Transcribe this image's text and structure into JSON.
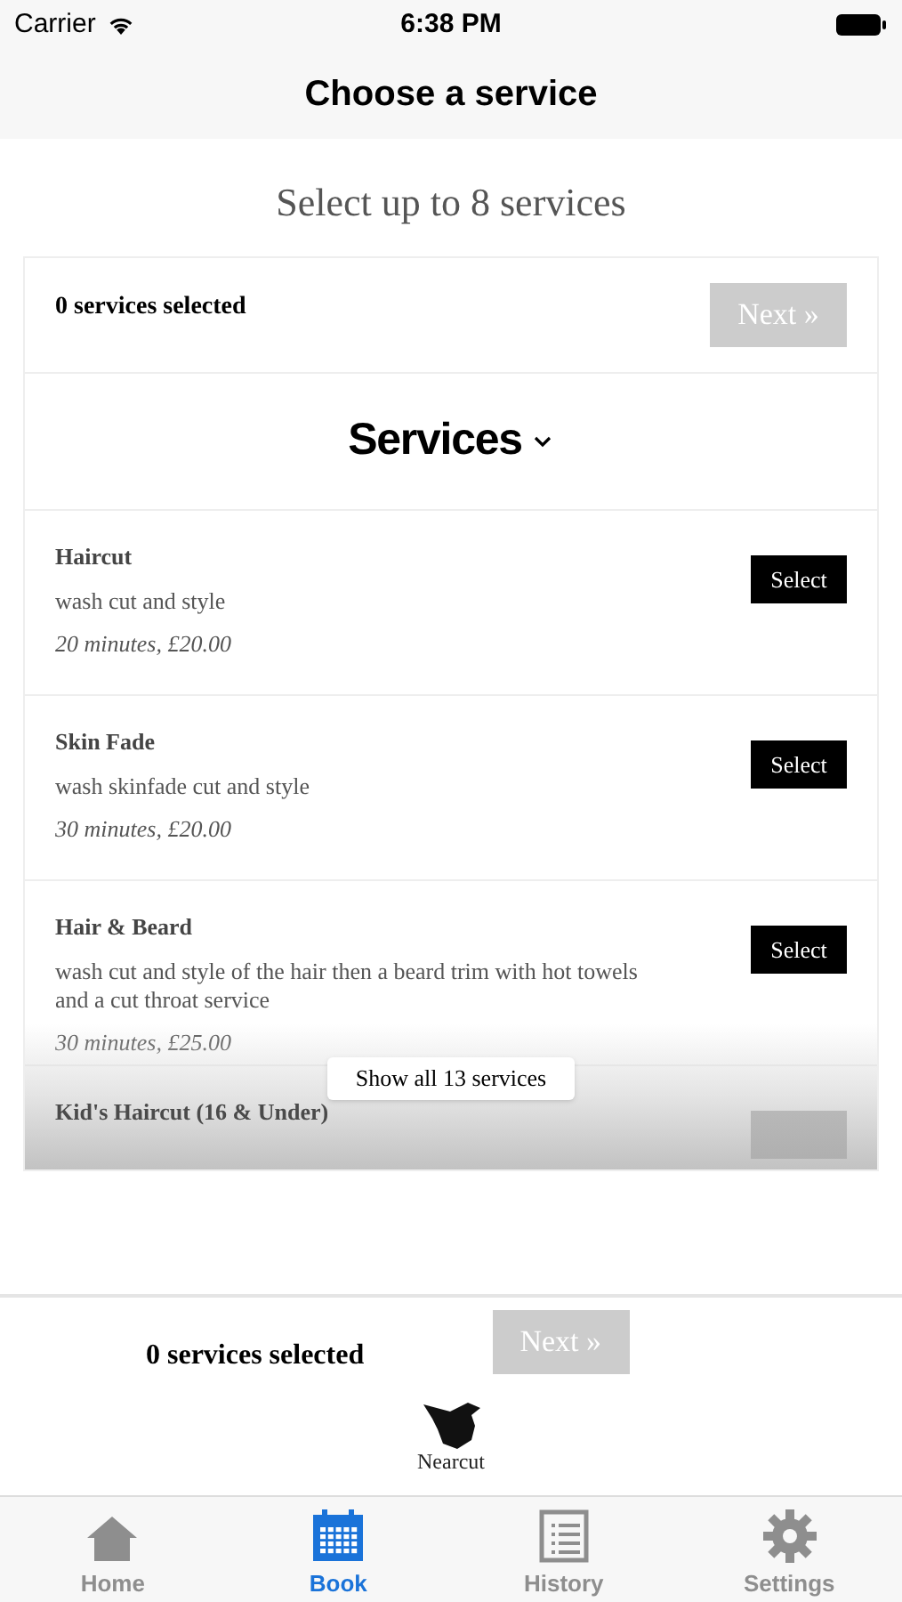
{
  "status_bar": {
    "carrier": "Carrier",
    "time": "6:38 PM"
  },
  "nav_bar": {
    "title": "Choose a service"
  },
  "heading": "Select up to 8 services",
  "selection_bar": {
    "count": "0 services selected",
    "next_button": {
      "label": "Next »",
      "disabled": true
    }
  },
  "category": {
    "title": "Services",
    "expanded": true
  },
  "services": [
    {
      "name": "Haircut",
      "description": "wash cut and style",
      "details": "20 minutes, £20.00",
      "button": "Select"
    },
    {
      "name": "Skin Fade",
      "description": "wash skinfade cut and  style",
      "details": "30 minutes, £20.00",
      "button": "Select"
    },
    {
      "name": "Hair & Beard",
      "description": "wash cut and style of the hair then a beard trim with hot towels and a cut throat service",
      "details": "30 minutes, £25.00",
      "button": "Select"
    },
    {
      "name": "Kid's Haircut (16 & Under)"
    }
  ],
  "show_all_button": "Show all 13 services",
  "footer_bar": {
    "count": "0 services selected",
    "next_button": {
      "label": "Next »",
      "disabled": true
    }
  },
  "brand": {
    "name": "Nearcut"
  },
  "tab_bar": [
    {
      "kind": "home",
      "label": "Home",
      "selected": false
    },
    {
      "kind": "book",
      "label": "Book",
      "selected": true
    },
    {
      "kind": "history",
      "label": "History",
      "selected": false
    },
    {
      "kind": "settings",
      "label": "Settings",
      "selected": false
    }
  ]
}
